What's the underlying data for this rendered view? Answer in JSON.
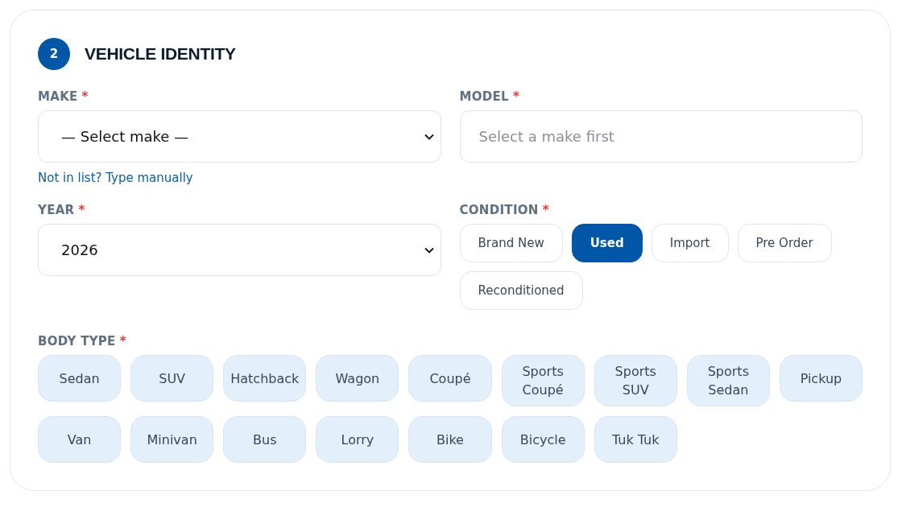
{
  "section": {
    "step": "2",
    "title": "VEHICLE IDENTITY"
  },
  "make": {
    "label": "MAKE",
    "required_mark": "*",
    "value": "— Select make —",
    "link": "Not in list? Type manually"
  },
  "model": {
    "label": "MODEL",
    "required_mark": "*",
    "placeholder": "Select a make first"
  },
  "year": {
    "label": "YEAR",
    "required_mark": "*",
    "value": "2026"
  },
  "condition": {
    "label": "CONDITION",
    "required_mark": "*",
    "options": [
      {
        "label": "Brand New",
        "selected": false
      },
      {
        "label": "Used",
        "selected": true
      },
      {
        "label": "Import",
        "selected": false
      },
      {
        "label": "Pre Order",
        "selected": false
      },
      {
        "label": "Reconditioned",
        "selected": false
      }
    ]
  },
  "body_type": {
    "label": "BODY TYPE",
    "required_mark": "*",
    "options": [
      {
        "label": "Sedan",
        "selected": false
      },
      {
        "label": "SUV",
        "selected": false
      },
      {
        "label": "Hatchback",
        "selected": false
      },
      {
        "label": "Wagon",
        "selected": false
      },
      {
        "label": "Coupé",
        "selected": false
      },
      {
        "label": "Sports Coupé",
        "selected": false
      },
      {
        "label": "Sports SUV",
        "selected": false
      },
      {
        "label": "Sports Sedan",
        "selected": false
      },
      {
        "label": "Pickup",
        "selected": false
      },
      {
        "label": "Van",
        "selected": false
      },
      {
        "label": "Minivan",
        "selected": false
      },
      {
        "label": "Bus",
        "selected": false
      },
      {
        "label": "Lorry",
        "selected": false
      },
      {
        "label": "Bike",
        "selected": false
      },
      {
        "label": "Bicycle",
        "selected": false
      },
      {
        "label": "Tuk Tuk",
        "selected": false
      }
    ]
  }
}
